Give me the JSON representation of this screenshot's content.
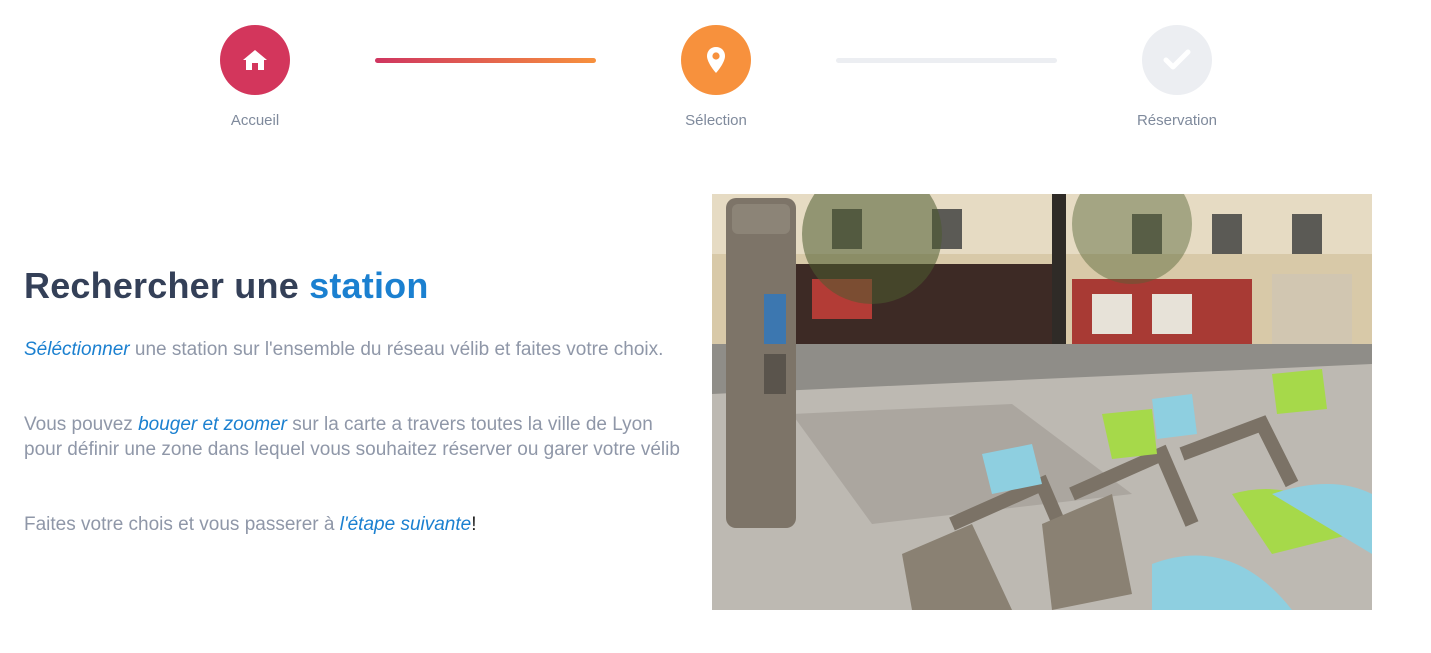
{
  "stepper": {
    "steps": [
      {
        "label": "Accueil",
        "icon": "home-icon",
        "color": "#d3365c",
        "state": "done"
      },
      {
        "label": "Sélection",
        "icon": "map-pin-icon",
        "color": "#f7913d",
        "state": "current"
      },
      {
        "label": "Réservation",
        "icon": "check-icon",
        "color": "#eceef2",
        "state": "upcoming"
      }
    ]
  },
  "content": {
    "title_part1": "Rechercher une",
    "title_accent": "station",
    "p1": {
      "link": "Séléctionner",
      "text": " une station sur l'ensemble du réseau vélib et faites votre choix."
    },
    "p2": {
      "before": "Vous pouvez ",
      "link": "bouger et zoomer",
      "after": " sur la carte a travers toutes la ville de Lyon pour définir une zone dans lequel vous souhaitez réserver ou garer votre vélib"
    },
    "p3": {
      "before": "Faites votre chois et vous passerer à ",
      "link": "l'étape suivante",
      "after": "!"
    }
  },
  "colors": {
    "accent_blue": "#1b80d0",
    "heading": "#344058",
    "body_text": "#8f97a8"
  }
}
